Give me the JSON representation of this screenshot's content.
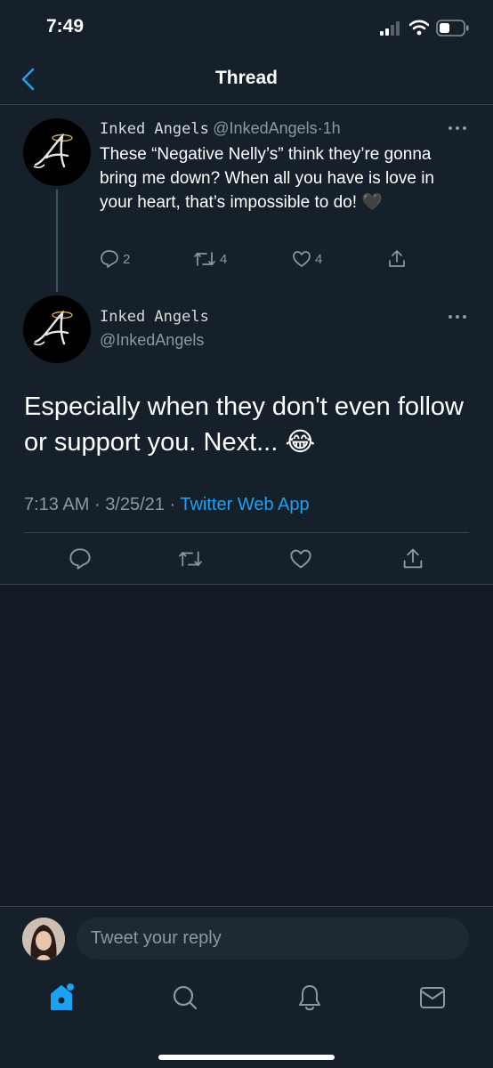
{
  "status_bar": {
    "time": "7:49"
  },
  "header": {
    "title": "Thread"
  },
  "thread_tweet": {
    "display_name": "Inked Angels",
    "handle": "@InkedAngels",
    "separator": "·",
    "time_ago": "1h",
    "text": "These “Negative Nelly’s” think they’re gonna bring me down?  When all you have is love in your heart, that’s impossible to do! 🖤",
    "replies": "2",
    "retweets": "4",
    "likes": "4"
  },
  "main_tweet": {
    "display_name": "Inked Angels",
    "handle": "@InkedAngels",
    "text": "Especially when they don't even follow or support you.  Next... 😂",
    "time": "7:13 AM",
    "separator": "·",
    "date": "3/25/21",
    "separator2": "·",
    "source": "Twitter Web App"
  },
  "reply": {
    "placeholder": "Tweet your reply"
  },
  "colors": {
    "background": "#15202b",
    "accent": "#1da1f2",
    "muted": "#8899a6",
    "divider": "#38444d"
  }
}
